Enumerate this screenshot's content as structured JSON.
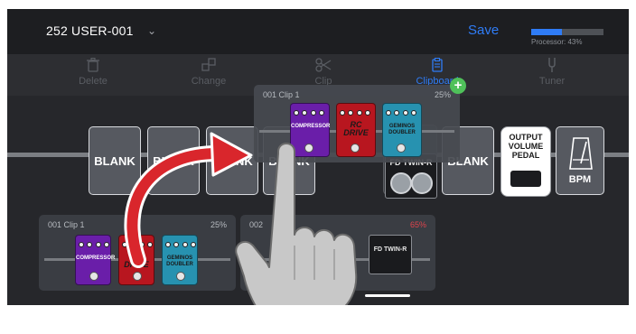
{
  "header": {
    "preset": "252 USER-001",
    "save_label": "Save",
    "processor_label": "Processor: 43%",
    "processor_fraction": 0.43,
    "accent": "#2f7cf6"
  },
  "toolbar": {
    "items": [
      {
        "label": "Delete",
        "icon": "trash-icon"
      },
      {
        "label": "Change",
        "icon": "swap-icon"
      },
      {
        "label": "Clip",
        "icon": "scissors-icon"
      },
      {
        "label": "Clipboard",
        "icon": "clipboard-icon"
      },
      {
        "label": "Tuner",
        "icon": "tuning-fork-icon"
      }
    ]
  },
  "chain": {
    "blank_label": "BLANK",
    "amp_label": "FD TWIN-R",
    "output_label": "OUTPUT VOLUME PEDAL",
    "bpm_label": "BPM"
  },
  "pedals": {
    "compressor": "COMPRESSOR",
    "rc_drive": "RC DRIVE",
    "geminos": "GEMINOS DOUBLER"
  },
  "clips": [
    {
      "name": "001  Clip 1",
      "percent": "25%"
    },
    {
      "name": "002",
      "percent": "65%"
    }
  ],
  "floating_clip": {
    "name": "001  Clip 1",
    "percent": "25%"
  }
}
